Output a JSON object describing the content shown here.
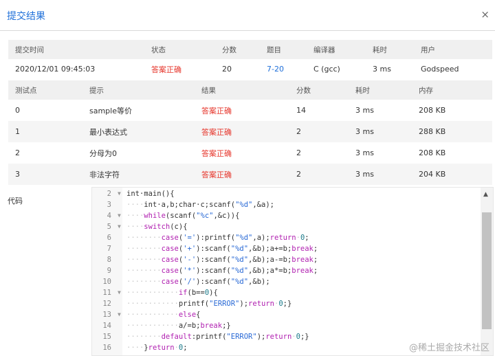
{
  "dialog": {
    "title": "提交结果",
    "close_symbol": "×"
  },
  "submission": {
    "headers": [
      "提交时间",
      "状态",
      "分数",
      "题目",
      "编译器",
      "耗时",
      "用户"
    ],
    "row": {
      "time": "2020/12/01 09:45:03",
      "status": "答案正确",
      "score": "20",
      "problem": "7-20",
      "compiler": "C (gcc)",
      "elapsed": "3 ms",
      "user": "Godspeed"
    }
  },
  "tests": {
    "headers": [
      "测试点",
      "提示",
      "结果",
      "分数",
      "耗时",
      "内存"
    ],
    "rows": [
      {
        "id": "0",
        "hint": "sample等价",
        "result": "答案正确",
        "score": "14",
        "time": "3 ms",
        "memory": "208 KB"
      },
      {
        "id": "1",
        "hint": "最小表达式",
        "result": "答案正确",
        "score": "2",
        "time": "3 ms",
        "memory": "288 KB"
      },
      {
        "id": "2",
        "hint": "分母为0",
        "result": "答案正确",
        "score": "2",
        "time": "3 ms",
        "memory": "208 KB"
      },
      {
        "id": "3",
        "hint": "非法字符",
        "result": "答案正确",
        "score": "2",
        "time": "3 ms",
        "memory": "204 KB"
      }
    ]
  },
  "code": {
    "label": "代码",
    "lines": [
      {
        "n": "2",
        "fold": true,
        "seg": [
          [
            "",
            "",
            "int·main(){"
          ]
        ]
      },
      {
        "n": "3",
        "fold": false,
        "seg": [
          [
            "ws",
            "····"
          ],
          [
            "",
            "int·a,b;char·c;scanf("
          ],
          [
            "st",
            "\"%d\""
          ],
          [
            "",
            ",&a);"
          ]
        ]
      },
      {
        "n": "4",
        "fold": true,
        "seg": [
          [
            "ws",
            "····"
          ],
          [
            "kw",
            "while"
          ],
          [
            "",
            "(scanf("
          ],
          [
            "st",
            "\"%c\""
          ],
          [
            "",
            ",&c)){"
          ]
        ]
      },
      {
        "n": "5",
        "fold": true,
        "seg": [
          [
            "ws",
            "····"
          ],
          [
            "kw",
            "switch"
          ],
          [
            "",
            "(c){"
          ]
        ]
      },
      {
        "n": "6",
        "fold": false,
        "seg": [
          [
            "ws",
            "········"
          ],
          [
            "kw",
            "case"
          ],
          [
            "",
            "("
          ],
          [
            "st",
            "'='"
          ],
          [
            "",
            "):printf("
          ],
          [
            "st",
            "\"%d\""
          ],
          [
            "",
            ",a);"
          ],
          [
            "kw",
            "return"
          ],
          [
            "ws",
            "·"
          ],
          [
            "nm",
            "0"
          ],
          [
            "",
            ";"
          ]
        ]
      },
      {
        "n": "7",
        "fold": false,
        "seg": [
          [
            "ws",
            "········"
          ],
          [
            "kw",
            "case"
          ],
          [
            "",
            "("
          ],
          [
            "st",
            "'+'"
          ],
          [
            "",
            "):scanf("
          ],
          [
            "st",
            "\"%d\""
          ],
          [
            "",
            ",&b);a+=b;"
          ],
          [
            "kw",
            "break"
          ],
          [
            "",
            ";"
          ]
        ]
      },
      {
        "n": "8",
        "fold": false,
        "seg": [
          [
            "ws",
            "········"
          ],
          [
            "kw",
            "case"
          ],
          [
            "",
            "("
          ],
          [
            "st",
            "'-'"
          ],
          [
            "",
            "):scanf("
          ],
          [
            "st",
            "\"%d\""
          ],
          [
            "",
            ",&b);a-=b;"
          ],
          [
            "kw",
            "break"
          ],
          [
            "",
            ";"
          ]
        ]
      },
      {
        "n": "9",
        "fold": false,
        "seg": [
          [
            "ws",
            "········"
          ],
          [
            "kw",
            "case"
          ],
          [
            "",
            "("
          ],
          [
            "st",
            "'*'"
          ],
          [
            "",
            "):scanf("
          ],
          [
            "st",
            "\"%d\""
          ],
          [
            "",
            ",&b);a*=b;"
          ],
          [
            "kw",
            "break"
          ],
          [
            "",
            ";"
          ]
        ]
      },
      {
        "n": "10",
        "fold": false,
        "seg": [
          [
            "ws",
            "········"
          ],
          [
            "kw",
            "case"
          ],
          [
            "",
            "("
          ],
          [
            "st",
            "'/'"
          ],
          [
            "",
            "):scanf("
          ],
          [
            "st",
            "\"%d\""
          ],
          [
            "",
            ",&b);"
          ]
        ]
      },
      {
        "n": "11",
        "fold": true,
        "seg": [
          [
            "ws",
            "············"
          ],
          [
            "kw",
            "if"
          ],
          [
            "",
            "(b=="
          ],
          [
            "nm",
            "0"
          ],
          [
            "",
            "){"
          ]
        ]
      },
      {
        "n": "12",
        "fold": false,
        "seg": [
          [
            "ws",
            "············"
          ],
          [
            "",
            "printf("
          ],
          [
            "st",
            "\"ERROR\""
          ],
          [
            "",
            ");"
          ],
          [
            "kw",
            "return"
          ],
          [
            "ws",
            "·"
          ],
          [
            "nm",
            "0"
          ],
          [
            "",
            ";}"
          ]
        ]
      },
      {
        "n": "13",
        "fold": true,
        "seg": [
          [
            "ws",
            "············"
          ],
          [
            "kw",
            "else"
          ],
          [
            "",
            "{"
          ]
        ]
      },
      {
        "n": "14",
        "fold": false,
        "seg": [
          [
            "ws",
            "············"
          ],
          [
            "",
            "a/=b;"
          ],
          [
            "kw",
            "break"
          ],
          [
            "",
            ";}"
          ]
        ]
      },
      {
        "n": "15",
        "fold": false,
        "seg": [
          [
            "ws",
            "········"
          ],
          [
            "kw",
            "default"
          ],
          [
            "",
            ":printf("
          ],
          [
            "st",
            "\"ERROR\""
          ],
          [
            "",
            ");"
          ],
          [
            "kw",
            "return"
          ],
          [
            "ws",
            "·"
          ],
          [
            "nm",
            "0"
          ],
          [
            "",
            ";}"
          ]
        ]
      },
      {
        "n": "16",
        "fold": false,
        "seg": [
          [
            "ws",
            "····"
          ],
          [
            "",
            "}"
          ],
          [
            "kw",
            "return"
          ],
          [
            "ws",
            "·"
          ],
          [
            "nm",
            "0"
          ],
          [
            "",
            ";"
          ]
        ]
      }
    ]
  },
  "scroll_up_symbol": "▲",
  "watermark": "@稀土掘金技术社区",
  "colors": {
    "accent": "#1e6fd9",
    "success": "#e6352b"
  }
}
